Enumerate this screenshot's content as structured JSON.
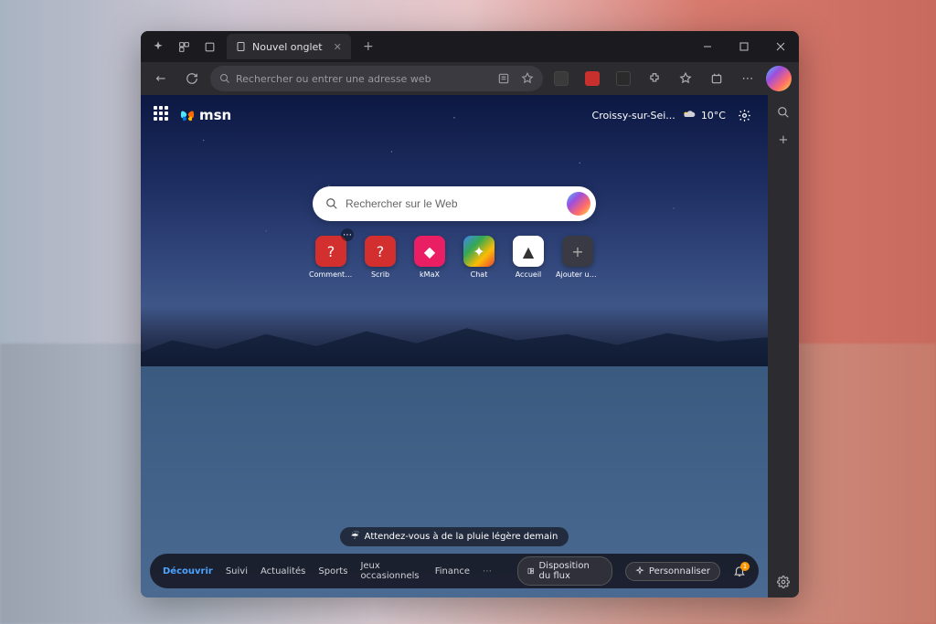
{
  "browser": {
    "tab": {
      "title": "Nouvel onglet"
    },
    "addressbar": {
      "placeholder": "Rechercher ou entrer une adresse web"
    }
  },
  "ntp": {
    "logo": "msn",
    "weather": {
      "location": "Croissy-sur-Sei...",
      "temp": "10°C"
    },
    "search": {
      "placeholder": "Rechercher sur le Web"
    },
    "tiles": [
      {
        "label": "Comment C..."
      },
      {
        "label": "Scrib"
      },
      {
        "label": "kMaX"
      },
      {
        "label": "Chat"
      },
      {
        "label": "Accueil"
      },
      {
        "label": "Ajouter un r..."
      }
    ],
    "forecast": "Attendez-vous à de la pluie légère demain",
    "footer": {
      "tabs": [
        {
          "label": "Découvrir",
          "active": true
        },
        {
          "label": "Suivi"
        },
        {
          "label": "Actualités"
        },
        {
          "label": "Sports"
        },
        {
          "label": "Jeux occasionnels"
        },
        {
          "label": "Finance"
        }
      ],
      "layout_btn": "Disposition du flux",
      "personalize_btn": "Personnaliser",
      "notif_count": "1"
    }
  }
}
